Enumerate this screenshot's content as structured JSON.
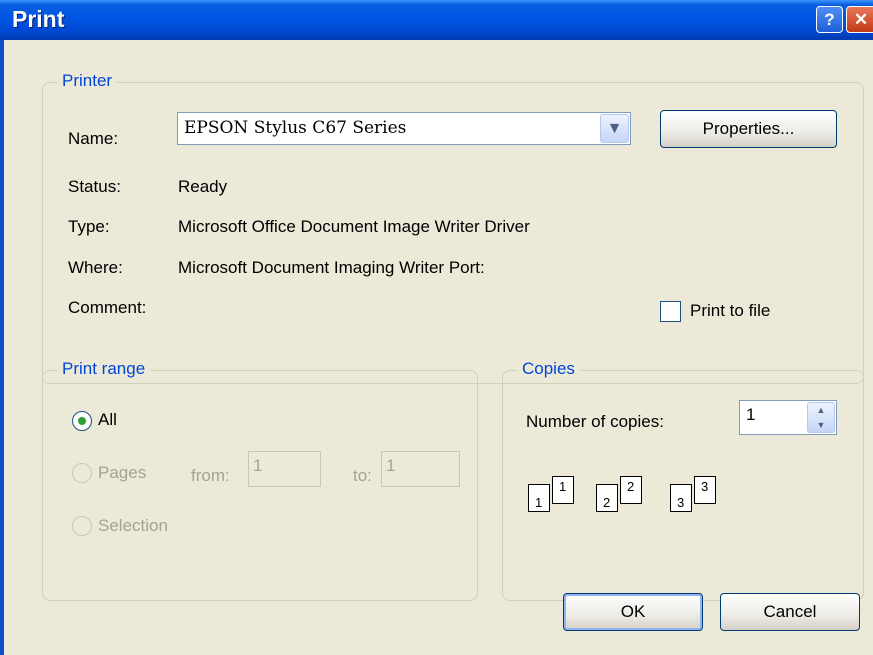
{
  "dialog": {
    "title": "Print"
  },
  "titlebar": {
    "help": "?",
    "close": "✕"
  },
  "printer": {
    "legend": "Printer",
    "name_label": "Name:",
    "name_value": "EPSON Stylus C67 Series",
    "properties_label": "Properties...",
    "status_label": "Status:",
    "status_value": "Ready",
    "type_label": "Type:",
    "type_value": "Microsoft Office Document Image Writer Driver",
    "where_label": "Where:",
    "where_value": "Microsoft Document Imaging Writer Port:",
    "comment_label": "Comment:",
    "print_to_file_label": "Print to file",
    "print_to_file_checked": false
  },
  "print_range": {
    "legend": "Print range",
    "all_label": "All",
    "pages_label": "Pages",
    "from_label": "from:",
    "from_value": "1",
    "to_label": "to:",
    "to_value": "1",
    "selection_label": "Selection",
    "selected": "All"
  },
  "copies": {
    "legend": "Copies",
    "number_label": "Number of copies:",
    "number_value": "1",
    "collate_icon": "collate-pages-icon",
    "collate_numbers": [
      "1",
      "1",
      "2",
      "2",
      "3",
      "3"
    ]
  },
  "buttons": {
    "ok": "OK",
    "cancel": "Cancel"
  },
  "colors": {
    "title_bar": "#0055e5",
    "dialog_bg": "#ece9d8",
    "legend_text": "#0046d5",
    "close_button": "#c23a16"
  }
}
